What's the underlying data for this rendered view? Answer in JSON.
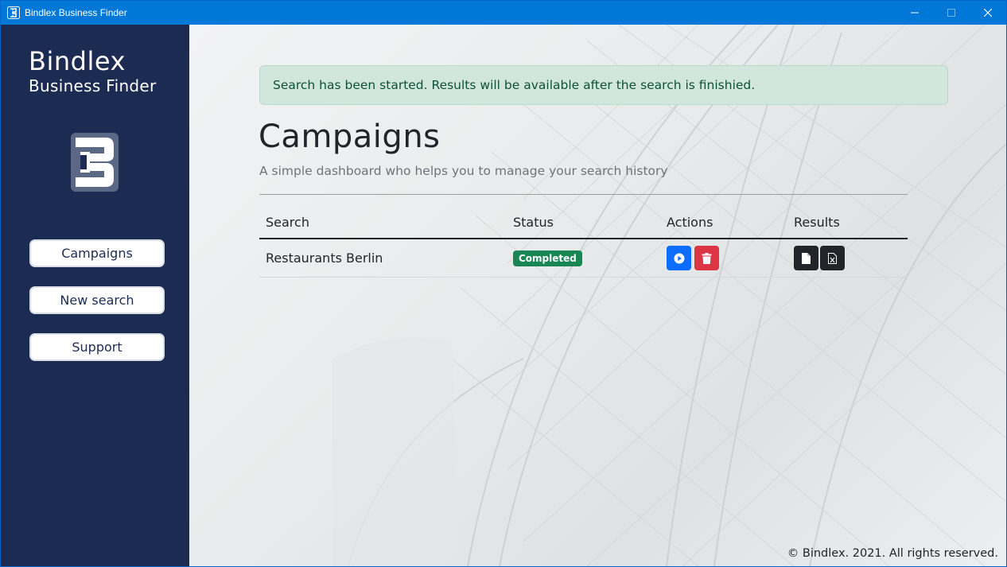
{
  "window": {
    "title": "Bindlex Business Finder",
    "icons": [
      "app-logo-icon",
      "minimize-icon",
      "maximize-icon",
      "close-icon"
    ]
  },
  "sidebar": {
    "brand_name": "Bindlex",
    "brand_sub": "Business Finder",
    "nav": [
      {
        "label": "Campaigns"
      },
      {
        "label": "New search"
      },
      {
        "label": "Support"
      }
    ]
  },
  "main": {
    "alert": "Search has been started. Results will be available after the search is finishied.",
    "title": "Campaigns",
    "subtitle": "A simple dashboard who helps you to manage your search history",
    "table": {
      "headers": [
        "Search",
        "Status",
        "Actions",
        "Results"
      ],
      "rows": [
        {
          "search": "Restaurants Berlin",
          "status": "Completed",
          "actions": [
            "play-icon",
            "trash-icon"
          ],
          "results": [
            "file-icon",
            "excel-file-icon"
          ]
        }
      ]
    },
    "footer": "© Bindlex. 2021. All rights reserved."
  },
  "colors": {
    "titlebar": "#0078d7",
    "sidebar": "#1b2b52",
    "alert_bg": "#d1e7dd",
    "alert_text": "#0f5132",
    "badge_success": "#198754",
    "btn_primary": "#0d6efd",
    "btn_danger": "#dc3545",
    "btn_dark": "#212529"
  }
}
